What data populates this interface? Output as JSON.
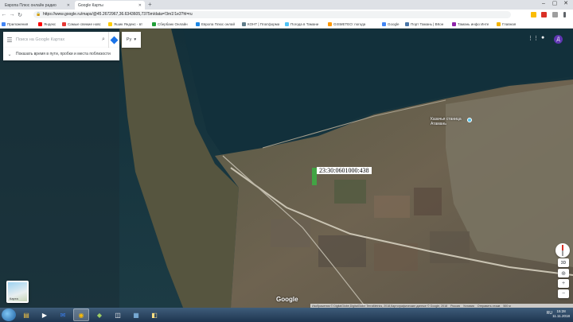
{
  "browser": {
    "tabs": [
      {
        "label": "Европа Плюс онлайн радио",
        "active": false
      },
      {
        "label": "Google Карты",
        "active": true
      }
    ],
    "url": "https://www.google.ru/maps/@45.2672967,36.6343605,7375m/data=!3m1!1e3?hl=ru",
    "bookmarks": [
      "Приложения",
      "Яндекс",
      "Самые свежие новс",
      "Яшик Яндекс - вт",
      "Сбербанк Онлайн",
      "Европа Плюс онлай",
      "КОНТ | Платформа",
      "Погода в Тамани",
      "GISMETEO: погода",
      "Google",
      "Порт Тамань | ВКон",
      "Тамань инфо Инте",
      "Главная"
    ]
  },
  "map": {
    "search_placeholder": "Поиск на Google Картах",
    "commute_text": "Показать время в пути, пробки и места поблизости",
    "language": "Ру",
    "parcel_label": "23:30:0601000:438",
    "place_label_line1": "Казачья станица",
    "place_label_line2": "Атамань",
    "layers_label": "Карта",
    "google_logo": "Google",
    "footer": {
      "attribution": "Изображения © DigitalGlobe,DigitalGlobe,TerraMetrics, 2018,Картографические данные © Google, 2018",
      "links": [
        "Россия",
        "Условия",
        "Отправить отзыв"
      ],
      "scale": "500 м"
    },
    "compass_3d": "3D",
    "zoom_in": "+",
    "zoom_out": "−"
  },
  "taskbar": {
    "time": "15:28",
    "date": "11.11.2018",
    "tray": "RU"
  },
  "colors": {
    "accent": "#1a73e8",
    "parcel": "#3cb043",
    "avatar": "#5e35b1"
  }
}
